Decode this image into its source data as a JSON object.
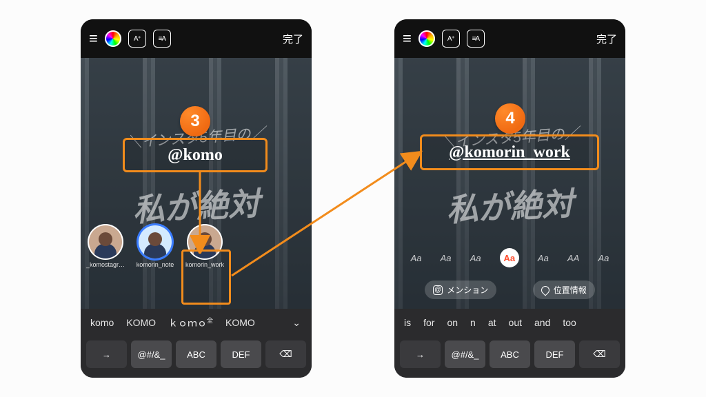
{
  "top": {
    "a_plus": "A⁺",
    "a_swap": "≡A",
    "done": "完了"
  },
  "handwriting": {
    "sub": "＼インスタ5年目の／",
    "main": "私が絶対"
  },
  "left": {
    "mention_text": "@komo",
    "suggestions": [
      {
        "name": "_komostagr…"
      },
      {
        "name": "komorin_note"
      },
      {
        "name": "komorin_work"
      }
    ],
    "predictions": [
      "komo",
      "KOMO",
      "ｋｏｍｏ",
      "KOMO"
    ],
    "pred_sup": "全"
  },
  "right": {
    "mention_text": "@komorin_work",
    "font_options": [
      "Aa",
      "Aa",
      "Aa",
      "Aa",
      "Aa",
      "AA",
      "Aa"
    ],
    "mention_btn": "メンション",
    "location_btn": "位置情報",
    "predictions": [
      "is",
      "for",
      "on",
      "n",
      "at",
      "out",
      "and",
      "too"
    ]
  },
  "keys": {
    "arrow": "→",
    "k1": "@#/&_",
    "k2": "ABC",
    "k3": "DEF",
    "del": "⌫"
  },
  "step3": "3",
  "step4": "4"
}
